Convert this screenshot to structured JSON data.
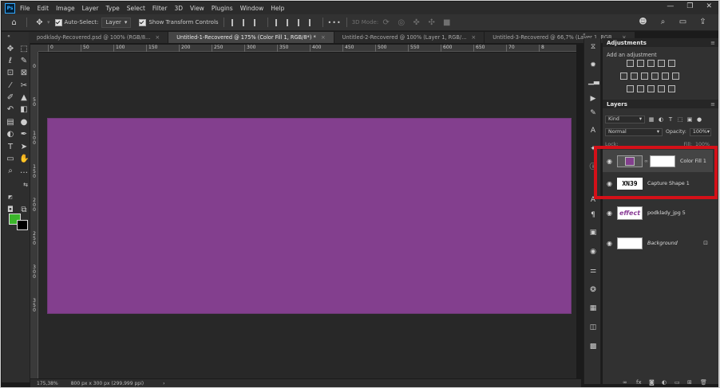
{
  "app": {
    "logo": "Ps"
  },
  "menu": [
    "File",
    "Edit",
    "Image",
    "Layer",
    "Type",
    "Select",
    "Filter",
    "3D",
    "View",
    "Plugins",
    "Window",
    "Help"
  ],
  "window_controls": [
    "—",
    "❐",
    "✕"
  ],
  "options_bar": {
    "auto_select_label": "Auto-Select:",
    "auto_select_value": "Layer",
    "transform_label": "Show Transform Controls",
    "mode_3d": "3D Mode:",
    "more": "•••"
  },
  "tabs": [
    {
      "label": "podklady-Recovered.psd @ 100% (RGB/8...",
      "close": "×",
      "active": false
    },
    {
      "label": "Untitled-1-Recovered @ 175% (Color Fill 1, RGB/8*) *",
      "close": "×",
      "active": true
    },
    {
      "label": "Untitled-2-Recovered @ 100% (Layer 1, RGB/...",
      "close": "×",
      "active": false
    },
    {
      "label": "Untitled-3-Recovered @ 66,7% (Layer 1, RGB...",
      "close": "×",
      "active": false
    }
  ],
  "ruler_top": [
    "0",
    "50",
    "100",
    "150",
    "200",
    "250",
    "300",
    "350",
    "400",
    "450",
    "500",
    "550",
    "600",
    "650",
    "70",
    "8"
  ],
  "ruler_left": [
    "0",
    "5 0",
    "1 0 0",
    "1 5 0",
    "2 0 0",
    "2 5 0",
    "3 0 0",
    "3 5 0"
  ],
  "canvas": {
    "fill_color": "#833f8e",
    "background": "#282828"
  },
  "status": {
    "zoom": "175,38%",
    "doc_info": "800 px x 300 px (299,999 ppi)",
    "arrow": "›"
  },
  "colors": {
    "foreground": "#3bb52b",
    "background": "#000000",
    "highlight": "#d41018"
  },
  "adjustments": {
    "title": "Adjustments",
    "add_label": "Add an adjustment"
  },
  "layers_panel": {
    "title": "Layers",
    "filter_kind": "Kind",
    "blend_mode": "Normal",
    "opacity_label": "Opacity:",
    "opacity_value": "100%",
    "lock_label": "Lock:",
    "fill_label": "Fill:",
    "fill_value": "100%",
    "layers": [
      {
        "name": "Color Fill 1",
        "visible": true,
        "selected": true,
        "type": "fill"
      },
      {
        "name": "Capture Shape 1",
        "visible": true,
        "selected": false,
        "type": "text",
        "thumb_text": "XN39"
      },
      {
        "name": "podklady_jpg 5",
        "visible": true,
        "selected": false,
        "type": "image",
        "thumb_text": "effect"
      },
      {
        "name": "Background",
        "visible": true,
        "selected": false,
        "type": "background",
        "locked": true
      }
    ]
  },
  "icons": {
    "eye": "👁",
    "lock": "🔒",
    "menu": "≡",
    "collapse": "«"
  }
}
